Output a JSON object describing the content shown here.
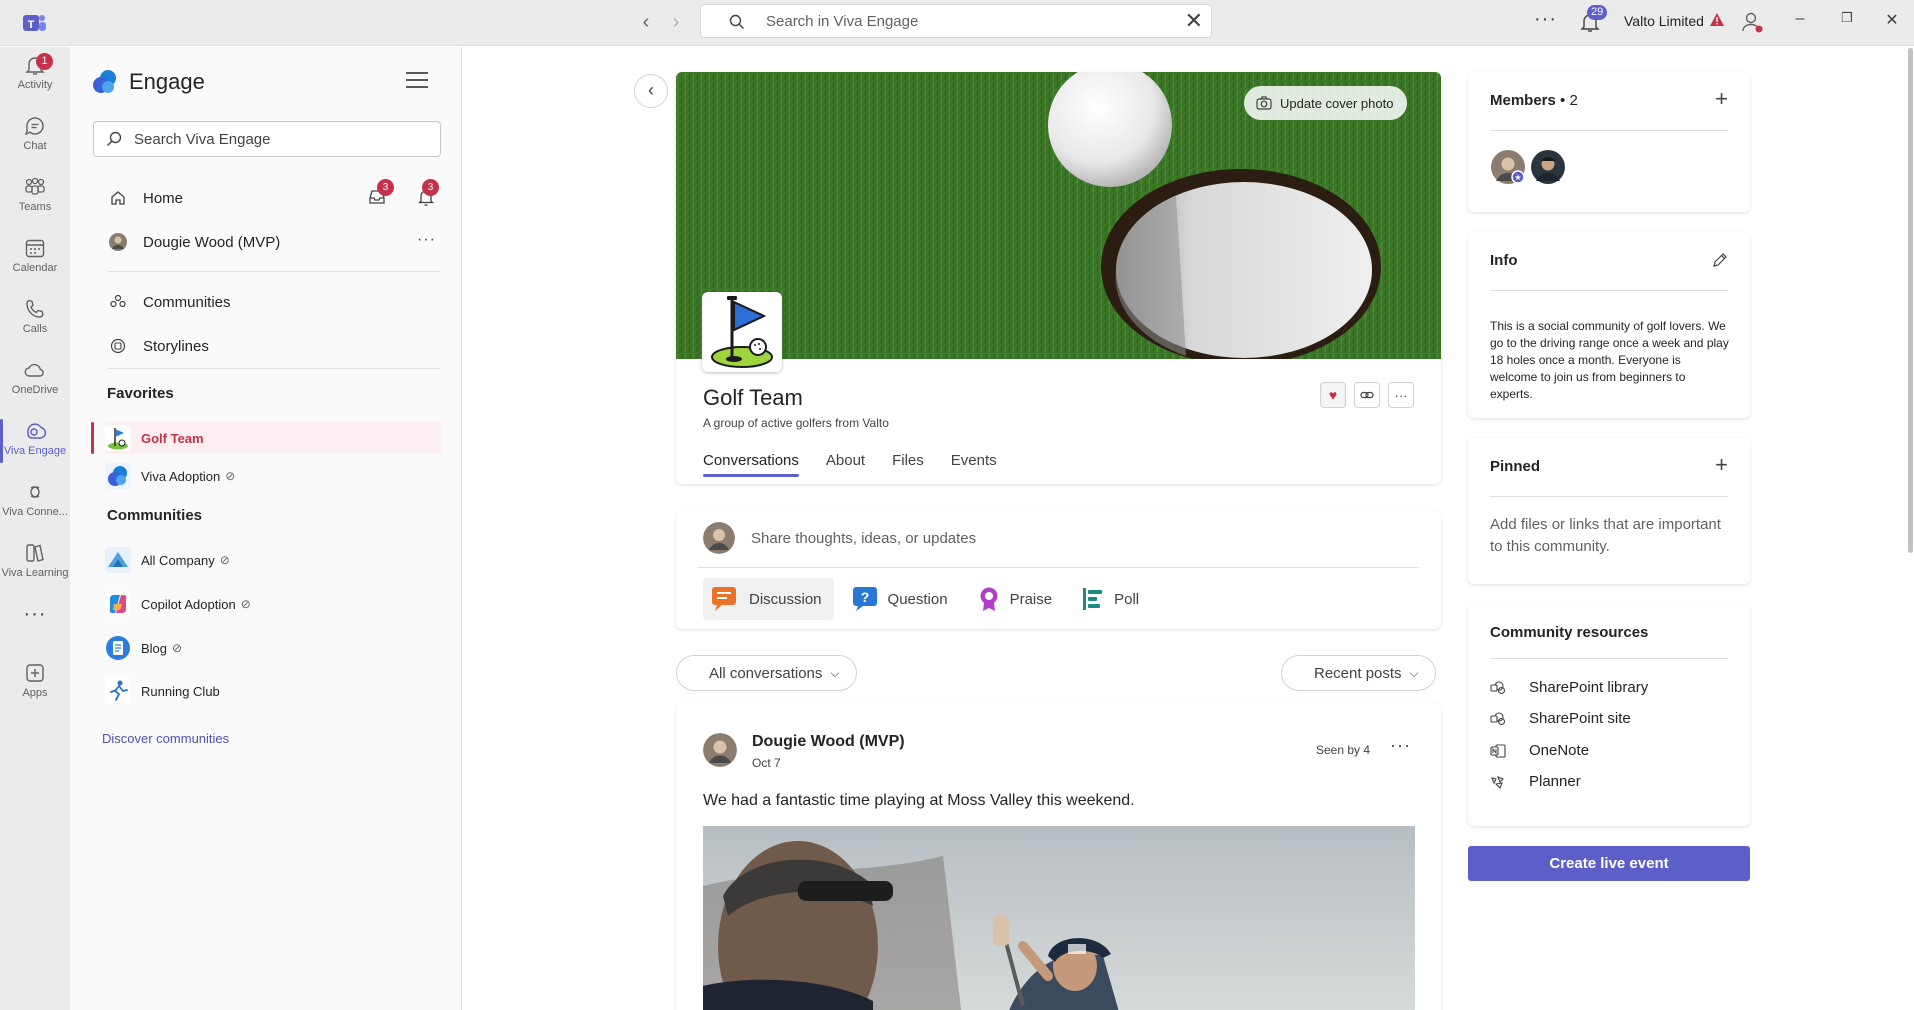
{
  "titlebar": {
    "search_placeholder": "Search in Viva Engage",
    "notification_count": "29",
    "org_name": "Valto Limited",
    "more_glyph": "···",
    "window_controls": [
      "minimize",
      "restore",
      "close"
    ]
  },
  "rail": {
    "items": [
      {
        "label": "Activity",
        "icon": "bell-icon",
        "badge": "1"
      },
      {
        "label": "Chat",
        "icon": "chat-icon"
      },
      {
        "label": "Teams",
        "icon": "teams-icon"
      },
      {
        "label": "Calendar",
        "icon": "calendar-icon"
      },
      {
        "label": "Calls",
        "icon": "phone-icon"
      },
      {
        "label": "OneDrive",
        "icon": "cloud-icon"
      },
      {
        "label": "Viva Engage",
        "icon": "engage-icon",
        "active": true
      },
      {
        "label": "Viva Conne...",
        "icon": "connections-icon"
      },
      {
        "label": "Viva Learning",
        "icon": "learning-icon"
      },
      {
        "label": "Apps",
        "icon": "add-apps-icon"
      }
    ],
    "more_glyph": "···"
  },
  "leftpane": {
    "brand": "Engage",
    "search_placeholder": "Search Viva Engage",
    "home_label": "Home",
    "inbox_badge": "3",
    "notifications_badge": "3",
    "profile_name": "Dougie Wood (MVP)",
    "communities_label": "Communities",
    "storylines_label": "Storylines",
    "favorites_header": "Favorites",
    "favorites": [
      {
        "name": "Golf Team",
        "selected": true
      },
      {
        "name": "Viva Adoption",
        "verified": true
      }
    ],
    "communities_header": "Communities",
    "communities": [
      {
        "name": "All Company",
        "verified": true
      },
      {
        "name": "Copilot Adoption",
        "verified": true
      },
      {
        "name": "Blog",
        "verified": true
      },
      {
        "name": "Running Club"
      }
    ],
    "discover_label": "Discover communities",
    "verified_glyph": "⊘"
  },
  "community": {
    "update_cover_label": "Update cover photo",
    "title": "Golf Team",
    "description": "A group of active golfers from Valto",
    "tabs": [
      {
        "label": "Conversations",
        "active": true
      },
      {
        "label": "About"
      },
      {
        "label": "Files"
      },
      {
        "label": "Events"
      }
    ]
  },
  "composer": {
    "placeholder": "Share thoughts, ideas, or updates",
    "types": [
      {
        "label": "Discussion",
        "icon": "discussion-icon",
        "selected": true
      },
      {
        "label": "Question",
        "icon": "question-icon"
      },
      {
        "label": "Praise",
        "icon": "praise-icon"
      },
      {
        "label": "Poll",
        "icon": "poll-icon"
      }
    ]
  },
  "filters": {
    "conversations_filter": "All conversations",
    "sort": "Recent posts"
  },
  "post": {
    "author": "Dougie Wood (MVP)",
    "date": "Oct 7",
    "seen": "Seen by 4",
    "more_glyph": "···",
    "body": "We had a fantastic time playing at Moss Valley this weekend."
  },
  "members": {
    "header": "Members",
    "count": "• 2"
  },
  "info": {
    "header": "Info",
    "text": "This is a social community of golf lovers. We go to the driving range once a week and play 18 holes once a month. Everyone is welcome to join us from beginners to experts."
  },
  "pinned": {
    "header": "Pinned",
    "text": "Add files or links that are important to this community."
  },
  "resources": {
    "header": "Community resources",
    "items": [
      {
        "label": "SharePoint library",
        "icon": "sharepoint-icon"
      },
      {
        "label": "SharePoint site",
        "icon": "sharepoint-icon"
      },
      {
        "label": "OneNote",
        "icon": "onenote-icon"
      },
      {
        "label": "Planner",
        "icon": "planner-icon"
      }
    ]
  },
  "live_event_label": "Create live event",
  "colors": {
    "accent": "#5b5fc7",
    "badge": "#c4314b",
    "favorite_selected": "#c4314b"
  }
}
